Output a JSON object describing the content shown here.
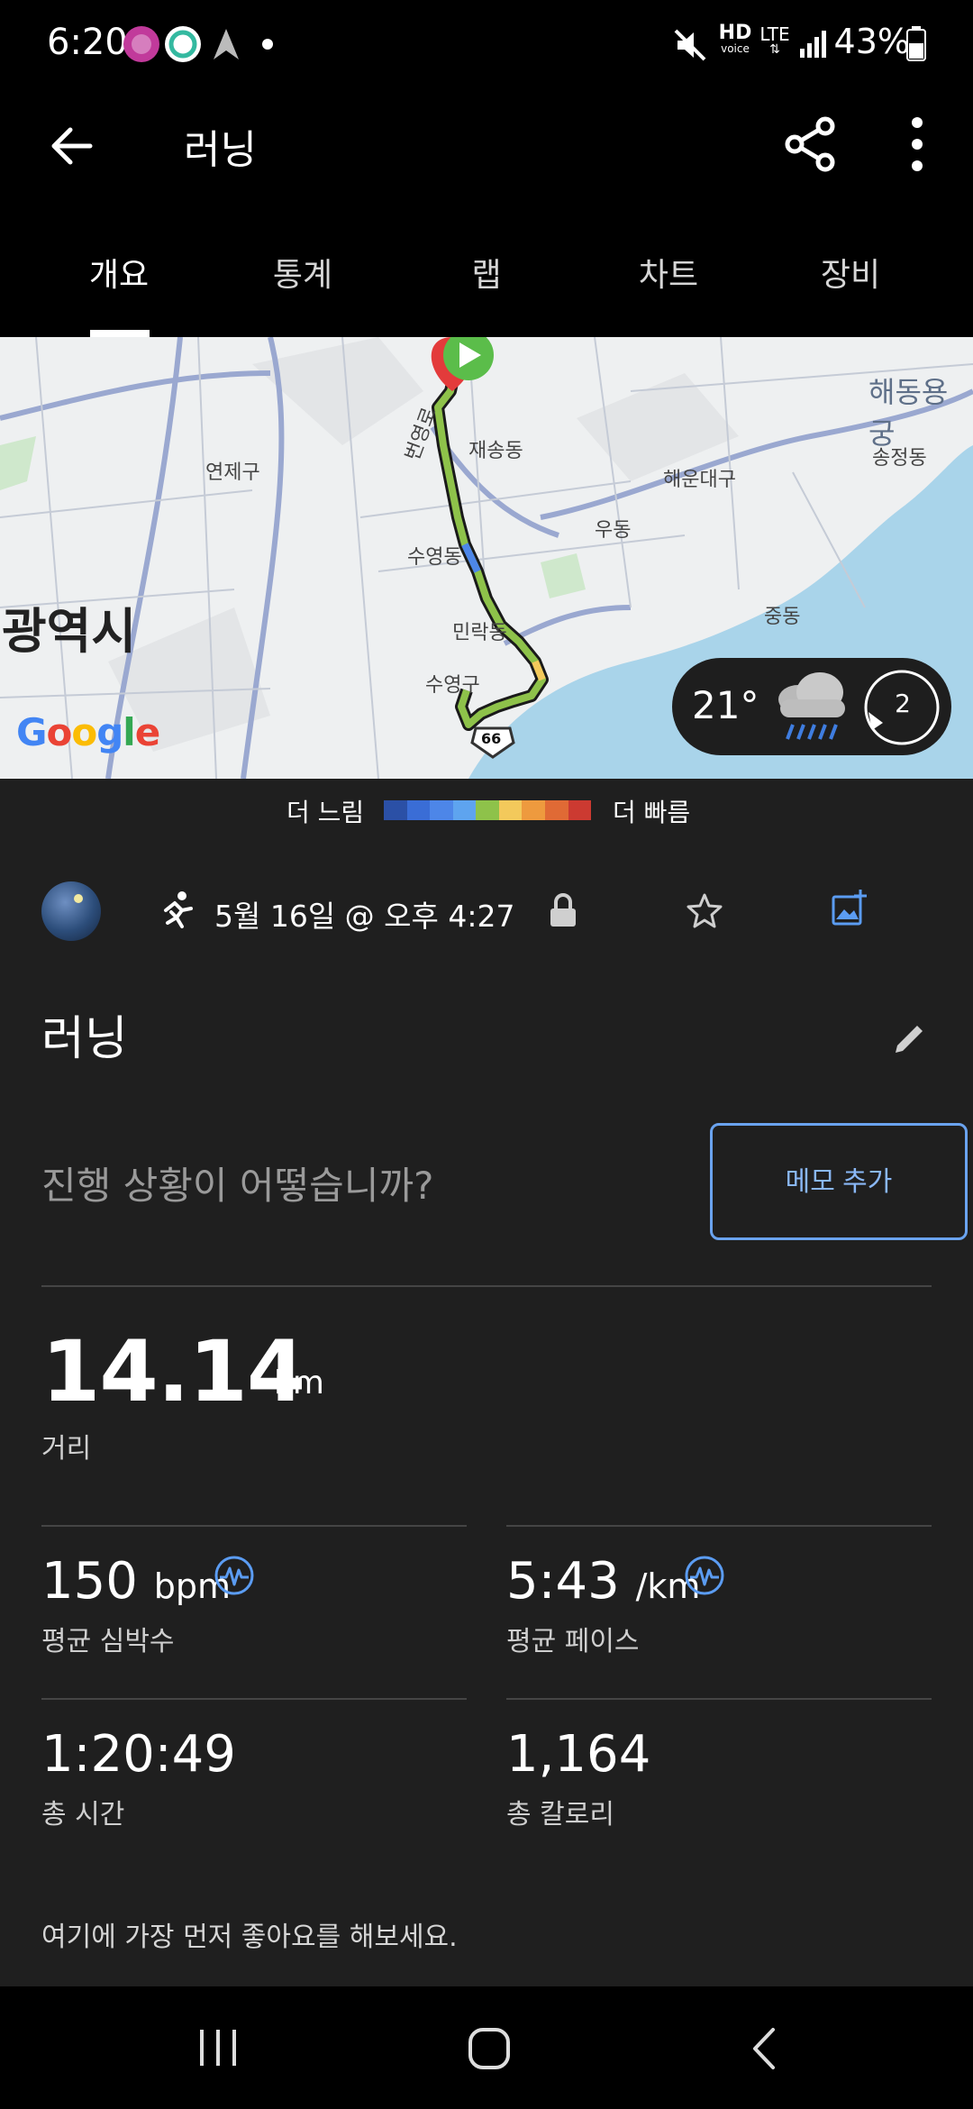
{
  "status_bar": {
    "time": "6:20",
    "battery_percent": "43%",
    "icons": [
      "busan-good-icon",
      "app-notification-icon",
      "navigation-icon",
      "dot-icon",
      "mute-icon",
      "hd-voice-icon",
      "lte-icon",
      "signal-icon",
      "battery-icon"
    ],
    "hd_label": "HD",
    "voice_label": "voice",
    "lte_label": "LTE"
  },
  "app_bar": {
    "title": "러닝",
    "back_icon": "back-arrow-icon",
    "share_icon": "share-icon",
    "more_icon": "more-vert-icon"
  },
  "tabs": [
    {
      "label": "개요",
      "active": true
    },
    {
      "label": "통계",
      "active": false
    },
    {
      "label": "랩",
      "active": false
    },
    {
      "label": "차트",
      "active": false
    },
    {
      "label": "장비",
      "active": false
    }
  ],
  "map": {
    "labels": {
      "yeonje": "연제구",
      "jaesong": "재송동",
      "haeundae": "해운대구",
      "haedong": "해동용궁",
      "songjeong": "송정동",
      "udong": "우동",
      "suyeongdong": "수영동",
      "minrak": "민락동",
      "suyeonggu": "수영구",
      "jungdong": "중동",
      "gwangyeoksi": "광역시",
      "road_bangyeong": "번영로",
      "route_66": "66"
    },
    "google_logo": "Google",
    "weather": {
      "temperature": "21°",
      "icon": "rain-cloud-icon",
      "wind": "2"
    }
  },
  "pace_legend": {
    "slow_label": "더 느림",
    "fast_label": "더 빠름",
    "colors": [
      "#2b50a6",
      "#3a6dd6",
      "#4d86e8",
      "#5ea4ef",
      "#8ec24a",
      "#f3c95b",
      "#ee9a3e",
      "#e06a35",
      "#cc3a31"
    ]
  },
  "activity": {
    "type_icon": "running-person-icon",
    "datetime": "5월 16일 @ 오후 4:27",
    "privacy_icon": "lock-icon",
    "favorite_icon": "star-outline-icon",
    "add_photo_icon": "add-photo-icon",
    "title": "러닝",
    "edit_icon": "edit-pencil-icon"
  },
  "memo": {
    "prompt": "진행 상황이 어떻습니까?",
    "button_label": "메모 추가"
  },
  "stats": {
    "distance": {
      "value": "14.14",
      "unit": "km",
      "label": "거리"
    },
    "heart_rate": {
      "value": "150",
      "unit": "bpm",
      "label": "평균 심박수"
    },
    "pace": {
      "value": "5:43",
      "unit": "/km",
      "label": "평균 페이스"
    },
    "duration": {
      "value": "1:20:49",
      "label": "총 시간"
    },
    "calories": {
      "value": "1,164",
      "label": "총 칼로리"
    }
  },
  "likes_prompt": "여기에 가장 먼저 좋아요를 해보세요.",
  "accent_color": "#6aa3ef"
}
